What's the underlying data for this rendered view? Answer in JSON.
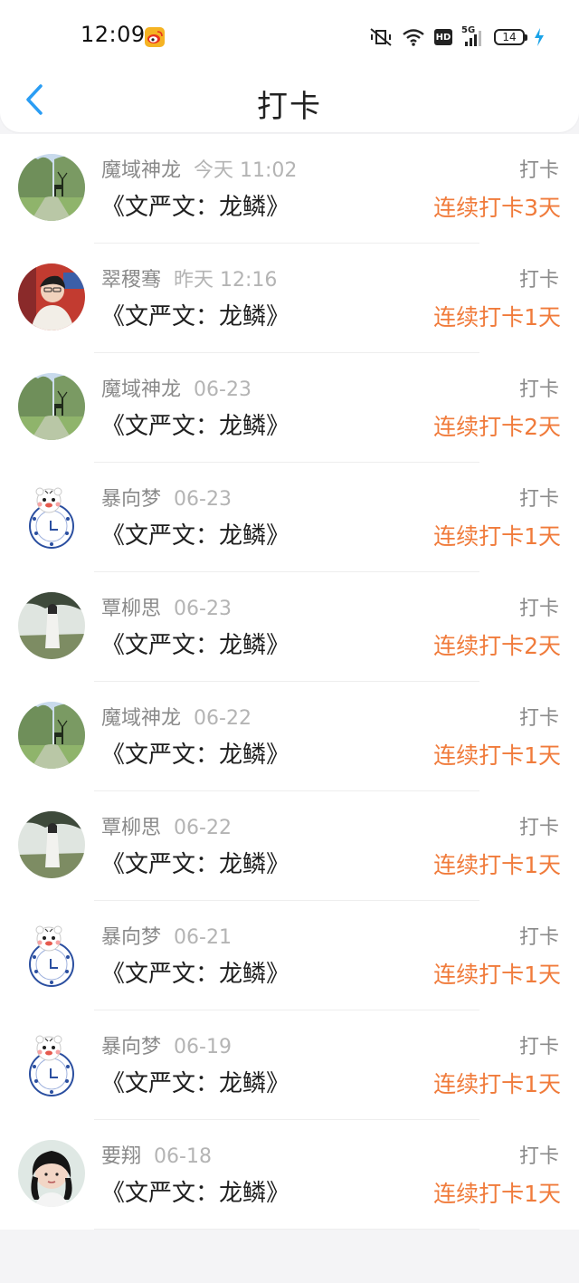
{
  "status_bar": {
    "time": "12:09",
    "battery": "14",
    "network": "5G",
    "hd_label": "HD"
  },
  "header": {
    "title": "打卡"
  },
  "colors": {
    "accent": "#2a9df4",
    "streak": "#f07b3b",
    "name_gray": "#8a8a8a",
    "date_gray": "#b4b4b4"
  },
  "items": [
    {
      "user": "魔域神龙",
      "date": "今天 11:02",
      "book": "《文严文：龙鳞》",
      "type": "打卡",
      "streak": "连续打卡3天",
      "avatar": "forest-deer"
    },
    {
      "user": "翠稷骞",
      "date": "昨天 12:16",
      "book": "《文严文：龙鳞》",
      "type": "打卡",
      "streak": "连续打卡1天",
      "avatar": "portrait"
    },
    {
      "user": "魔域神龙",
      "date": "06-23",
      "book": "《文严文：龙鳞》",
      "type": "打卡",
      "streak": "连续打卡2天",
      "avatar": "forest-deer"
    },
    {
      "user": "暴向梦",
      "date": "06-23",
      "book": "《文严文：龙鳞》",
      "type": "打卡",
      "streak": "连续打卡1天",
      "avatar": "cartoon-tiger"
    },
    {
      "user": "覃柳思",
      "date": "06-23",
      "book": "《文严文：龙鳞》",
      "type": "打卡",
      "streak": "连续打卡2天",
      "avatar": "field-girl"
    },
    {
      "user": "魔域神龙",
      "date": "06-22",
      "book": "《文严文：龙鳞》",
      "type": "打卡",
      "streak": "连续打卡1天",
      "avatar": "forest-deer"
    },
    {
      "user": "覃柳思",
      "date": "06-22",
      "book": "《文严文：龙鳞》",
      "type": "打卡",
      "streak": "连续打卡1天",
      "avatar": "field-girl"
    },
    {
      "user": "暴向梦",
      "date": "06-21",
      "book": "《文严文：龙鳞》",
      "type": "打卡",
      "streak": "连续打卡1天",
      "avatar": "cartoon-tiger"
    },
    {
      "user": "暴向梦",
      "date": "06-19",
      "book": "《文严文：龙鳞》",
      "type": "打卡",
      "streak": "连续打卡1天",
      "avatar": "cartoon-tiger"
    },
    {
      "user": "要翔",
      "date": "06-18",
      "book": "《文严文：龙鳞》",
      "type": "打卡",
      "streak": "连续打卡1天",
      "avatar": "dark-hair"
    }
  ]
}
